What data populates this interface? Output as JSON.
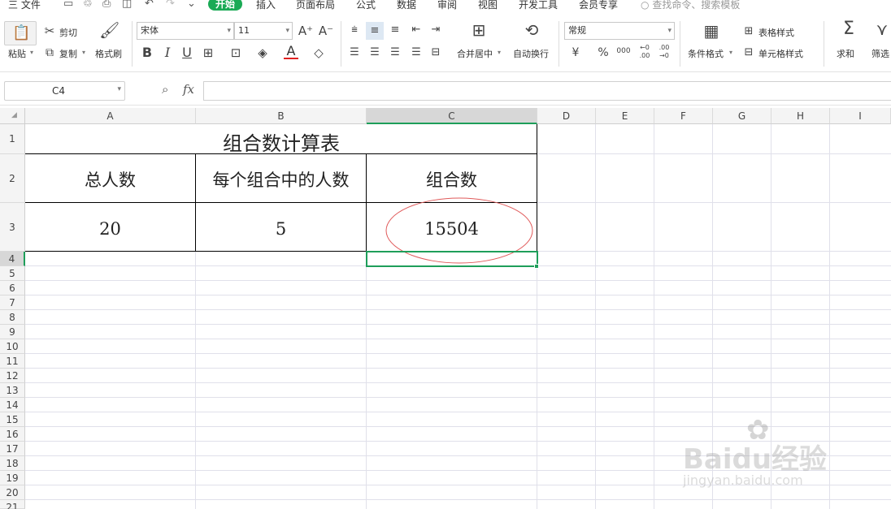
{
  "menu": {
    "file": "三 文件",
    "tabs": [
      "开始",
      "插入",
      "页面布局",
      "公式",
      "数据",
      "审阅",
      "视图",
      "开发工具",
      "会员专享"
    ],
    "active_tab": "开始",
    "search_placeholder": "查找命令、搜索模板"
  },
  "ribbon": {
    "paste": "粘贴",
    "cut": "剪切",
    "copy": "复制",
    "format_painter": "格式刷",
    "font_name": "宋体",
    "font_size": "11",
    "merge_center": "合并居中",
    "wrap_text": "自动换行",
    "number_format": "常规",
    "currency_symbol": "¥",
    "percent_symbol": "%",
    "thousands_symbol": "000",
    "conditional_format": "条件格式",
    "table_style": "表格样式",
    "cell_style": "单元格样式",
    "sum": "求和",
    "filter": "筛选"
  },
  "formula_bar": {
    "cell_ref": "C4",
    "fx_label": "fx",
    "formula": ""
  },
  "sheet": {
    "columns": [
      "A",
      "B",
      "C",
      "D",
      "E",
      "F",
      "G",
      "H",
      "I"
    ],
    "rows": [
      "1",
      "2",
      "3",
      "4",
      "5",
      "6",
      "7",
      "8",
      "9",
      "10",
      "11",
      "12",
      "13",
      "14",
      "15",
      "16",
      "17",
      "18",
      "19",
      "20",
      "21"
    ],
    "title": "组合数计算表",
    "headers": [
      "总人数",
      "每个组合中的人数",
      "组合数"
    ],
    "values": [
      "20",
      "5",
      "15504"
    ],
    "selected_cell": "C4"
  },
  "watermark": {
    "brand": "Baidu经验",
    "url": "jingyan.baidu.com"
  },
  "colors": {
    "accent": "#1aaa55",
    "selection": "#1e9e5a",
    "annotation_ellipse": "#e05a5a"
  }
}
